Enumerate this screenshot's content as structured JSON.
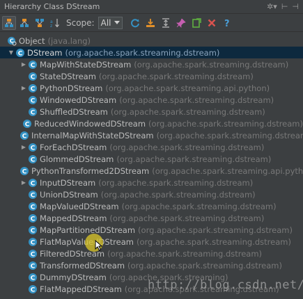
{
  "window": {
    "title": "Hierarchy Class DStream",
    "settings_label": "✲▾",
    "pin_label": "⊢",
    "close_label": "⊣"
  },
  "toolbar": {
    "scope_label": "Scope:",
    "scope_value": "All",
    "colors": {
      "blue": "#3592c4",
      "orange": "#e08f2a",
      "green": "#5fb040",
      "red": "#d9534f",
      "pink": "#c55fb0",
      "help": "#4a9fd8"
    }
  },
  "tree": {
    "root": {
      "name": "Object",
      "pkg": "(java.lang)"
    },
    "selected": {
      "name": "DStream",
      "pkg": "(org.apache.spark.streaming.dstream)"
    },
    "children": [
      {
        "name": "MapWithStateDStream",
        "pkg": "(org.apache.spark.streaming.dstream)",
        "expandable": true
      },
      {
        "name": "StateDStream",
        "pkg": "(org.apache.spark.streaming.dstream)",
        "expandable": false
      },
      {
        "name": "PythonDStream",
        "pkg": "(org.apache.spark.streaming.api.python)",
        "expandable": true
      },
      {
        "name": "WindowedDStream",
        "pkg": "(org.apache.spark.streaming.dstream)",
        "expandable": false
      },
      {
        "name": "ShuffledDStream",
        "pkg": "(org.apache.spark.streaming.dstream)",
        "expandable": false
      },
      {
        "name": "ReducedWindowedDStream",
        "pkg": "(org.apache.spark.streaming.dstream)",
        "expandable": false
      },
      {
        "name": "InternalMapWithStateDStream",
        "pkg": "(org.apache.spark.streaming.dstream)",
        "expandable": false
      },
      {
        "name": "ForEachDStream",
        "pkg": "(org.apache.spark.streaming.dstream)",
        "expandable": true
      },
      {
        "name": "GlommedDStream",
        "pkg": "(org.apache.spark.streaming.dstream)",
        "expandable": false
      },
      {
        "name": "PythonTransformed2DStream",
        "pkg": "(org.apache.spark.streaming.api.python)",
        "expandable": false
      },
      {
        "name": "InputDStream",
        "pkg": "(org.apache.spark.streaming.dstream)",
        "expandable": true
      },
      {
        "name": "UnionDStream",
        "pkg": "(org.apache.spark.streaming.dstream)",
        "expandable": false
      },
      {
        "name": "MapValuedDStream",
        "pkg": "(org.apache.spark.streaming.dstream)",
        "expandable": false
      },
      {
        "name": "MappedDStream",
        "pkg": "(org.apache.spark.streaming.dstream)",
        "expandable": false
      },
      {
        "name": "MapPartitionedDStream",
        "pkg": "(org.apache.spark.streaming.dstream)",
        "expandable": false
      },
      {
        "name": "FlatMapValuedDStream",
        "pkg": "(org.apache.spark.streaming.dstream)",
        "expandable": false
      },
      {
        "name": "FilteredDStream",
        "pkg": "(org.apache.spark.streaming.dstream)",
        "expandable": false
      },
      {
        "name": "TransformedDStream",
        "pkg": "(org.apache.spark.streaming.dstream)",
        "expandable": false
      },
      {
        "name": "DummyDStream",
        "pkg": "(org.apache.spark.streaming)",
        "expandable": false
      },
      {
        "name": "FlatMappedDStream",
        "pkg": "(org.apache.spark.streaming.dstream)",
        "expandable": false
      }
    ]
  },
  "watermark": "http://blog.csdn.net/"
}
